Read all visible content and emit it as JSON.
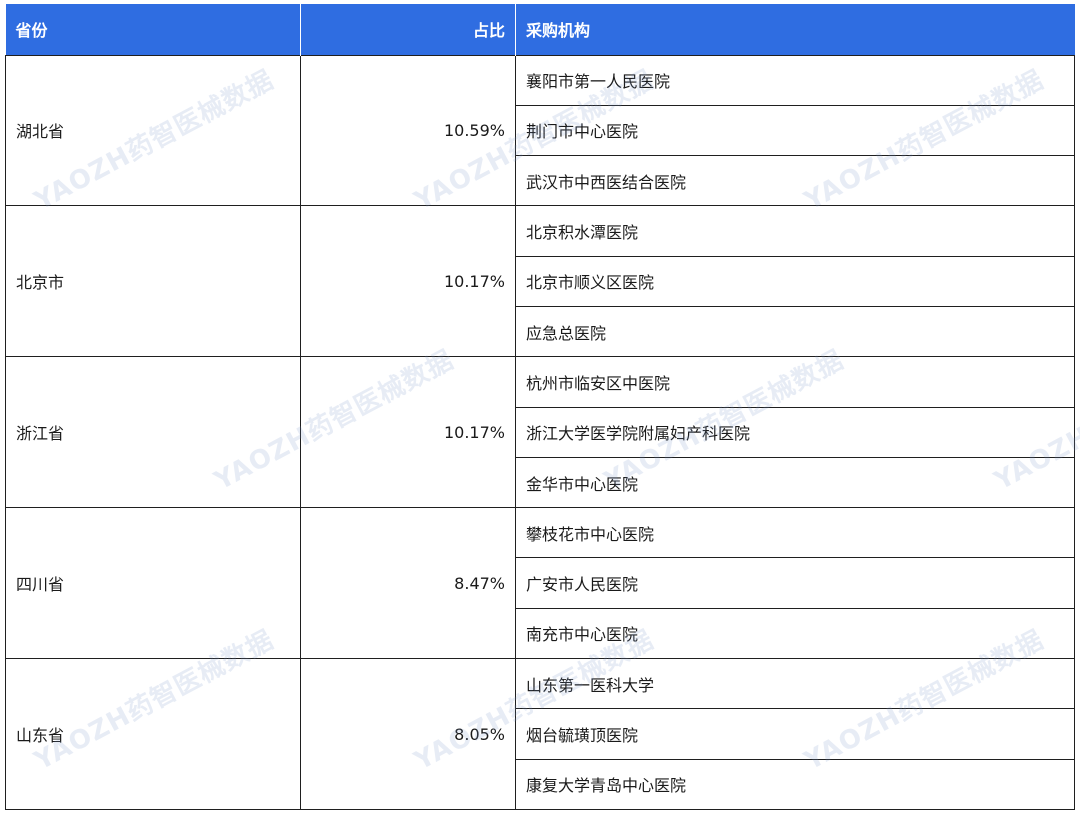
{
  "table": {
    "headers": {
      "province": "省份",
      "ratio": "占比",
      "institution": "采购机构"
    },
    "groups": [
      {
        "province": "湖北省",
        "ratio": "10.59%",
        "institutions": [
          "襄阳市第一人民医院",
          "荆门市中心医院",
          "武汉市中西医结合医院"
        ]
      },
      {
        "province": "北京市",
        "ratio": "10.17%",
        "institutions": [
          "北京积水潭医院",
          "北京市顺义区医院",
          "应急总医院"
        ]
      },
      {
        "province": "浙江省",
        "ratio": "10.17%",
        "institutions": [
          "杭州市临安区中医院",
          "浙江大学医学院附属妇产科医院",
          "金华市中心医院"
        ]
      },
      {
        "province": "四川省",
        "ratio": "8.47%",
        "institutions": [
          "攀枝花市中心医院",
          "广安市人民医院",
          "南充市中心医院"
        ]
      },
      {
        "province": "山东省",
        "ratio": "8.05%",
        "institutions": [
          "山东第一医科大学",
          "烟台毓璜顶医院",
          "康复大学青岛中心医院"
        ]
      }
    ]
  },
  "watermark": {
    "text": "YAOZH药智医械数据"
  }
}
